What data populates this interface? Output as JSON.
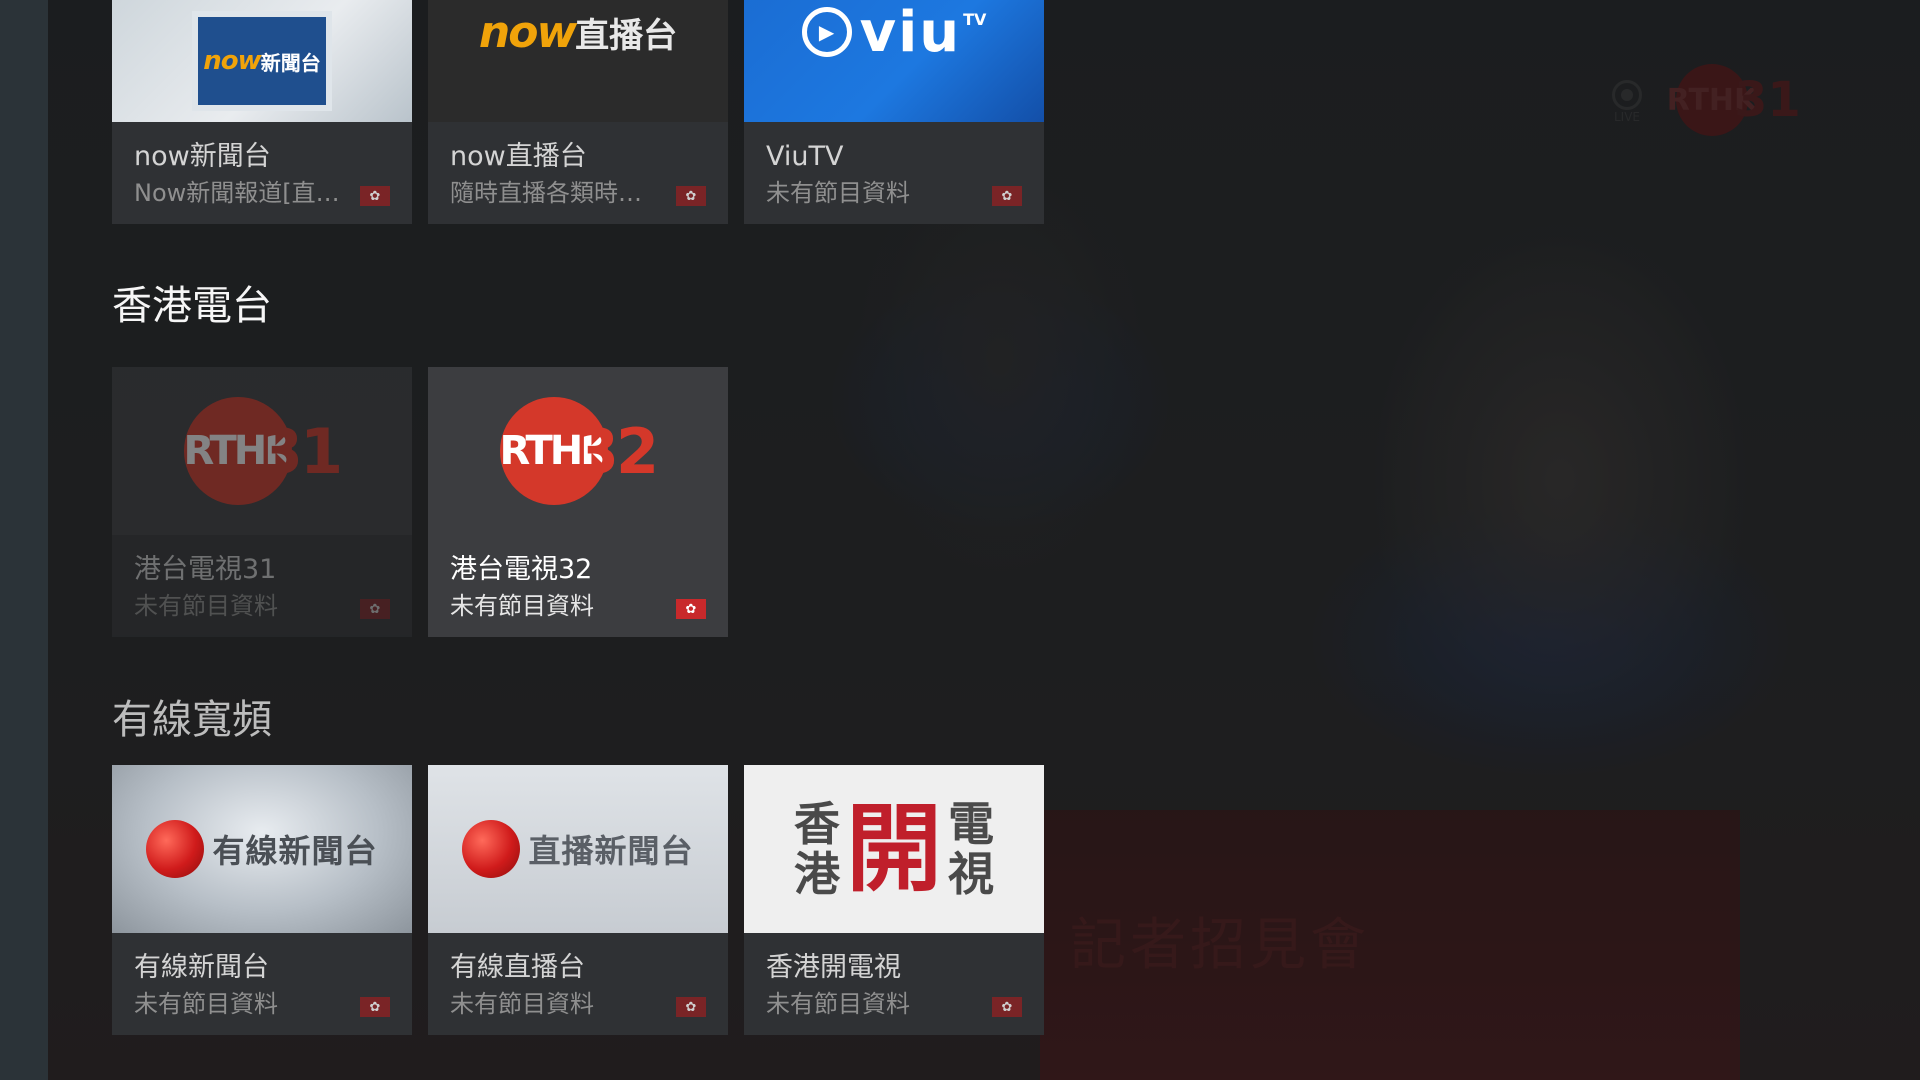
{
  "app": {
    "left_rail": "",
    "colors": {
      "accent_red": "#c8292b",
      "rthk_red": "#d4382a",
      "background": "#1c2023",
      "card": "#2f3134",
      "card_focused": "#3c3d40"
    }
  },
  "video": {
    "live_label": "LIVE",
    "watermark_logo": "RTHK31",
    "podium_text": "記者招見會"
  },
  "sections": [
    {
      "title": "",
      "cards": [
        {
          "name": "now新聞台",
          "program": "Now新聞報道[直播]",
          "logo_latin": "now",
          "logo_cn": "新聞台",
          "region_icon": "hk-flag-icon"
        },
        {
          "name": "now直播台",
          "program": "隨時直播各類時事…",
          "logo_latin": "now",
          "logo_cn": "直播台",
          "region_icon": "hk-flag-icon"
        },
        {
          "name": "ViuTV",
          "program": "未有節目資料",
          "logo_latin": "viu",
          "logo_cn": "TV",
          "region_icon": "hk-flag-icon"
        }
      ]
    },
    {
      "title": "香港電台",
      "cards": [
        {
          "name": "港台電視31",
          "program": "未有節目資料",
          "logo_latin": "RTHK",
          "logo_cn": "31",
          "region_icon": "hk-flag-icon",
          "focused": false
        },
        {
          "name": "港台電視32",
          "program": "未有節目資料",
          "logo_latin": "RTHK",
          "logo_cn": "32",
          "region_icon": "hk-flag-icon",
          "focused": true
        }
      ]
    },
    {
      "title": "有線寬頻",
      "cards": [
        {
          "name": "有線新聞台",
          "program": "未有節目資料",
          "logo_cn": "有線新聞台",
          "region_icon": "hk-flag-icon"
        },
        {
          "name": "有線直播台",
          "program": "未有節目資料",
          "logo_cn": "直播新聞台",
          "region_icon": "hk-flag-icon"
        },
        {
          "name": "香港開電視",
          "program": "未有節目資料",
          "logo_left": [
            "香",
            "港"
          ],
          "logo_mid": "開",
          "logo_right": [
            "電",
            "視"
          ],
          "region_icon": "hk-flag-icon"
        }
      ]
    }
  ],
  "flag_glyph": "✿"
}
